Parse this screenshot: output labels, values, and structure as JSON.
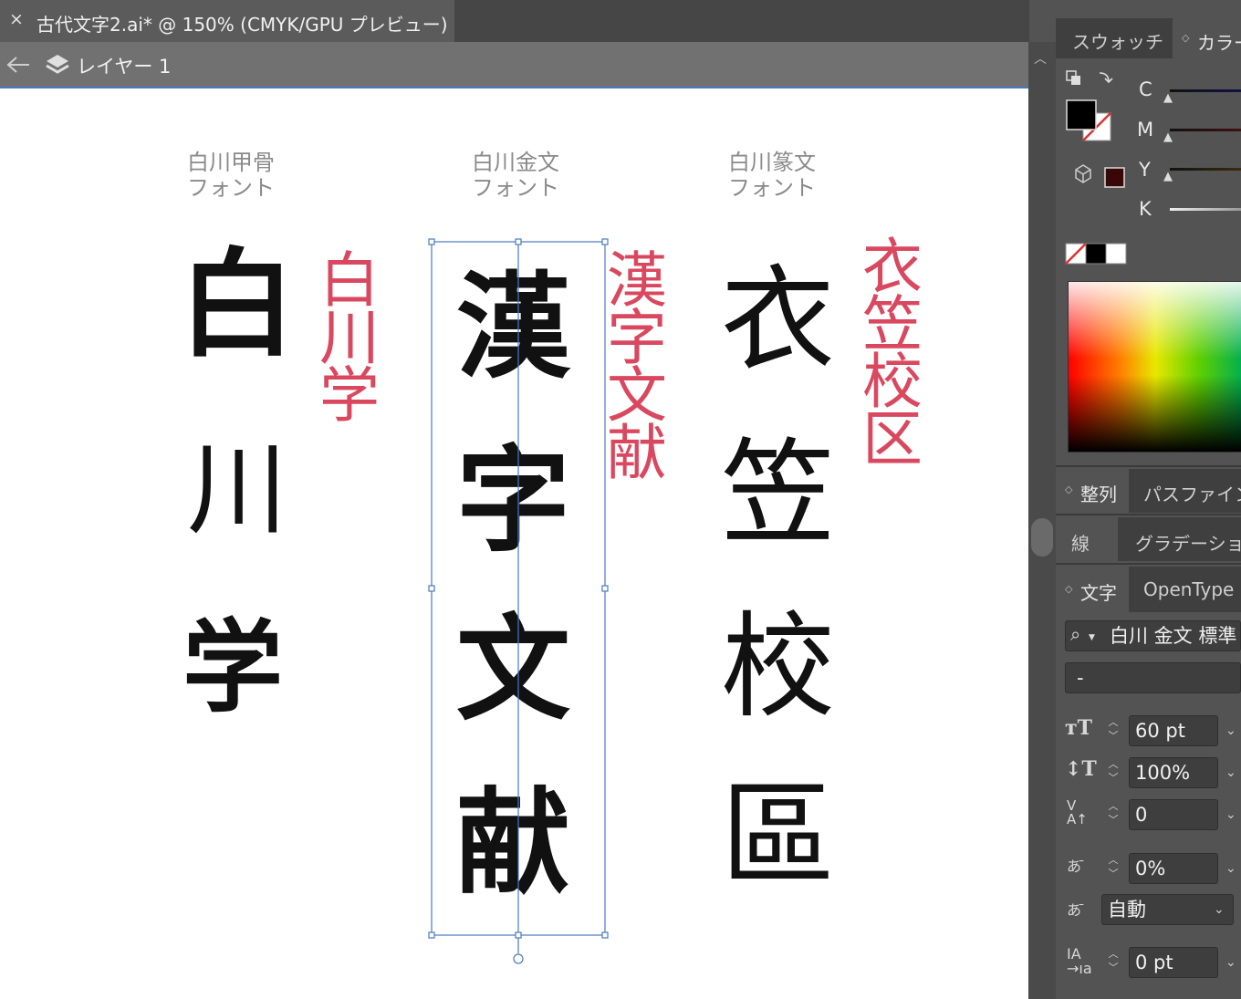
{
  "document_tab": {
    "close_icon": "×",
    "title": "古代文字2.ai* @ 150% (CMYK/GPU プレビュー)"
  },
  "layer_bar": {
    "layer_name": "レイヤー 1"
  },
  "canvas": {
    "columns": [
      {
        "label": "白川甲骨\nフォント",
        "red_text": "白川学",
        "seal_chars": [
          "白",
          "川",
          "学"
        ]
      },
      {
        "label": "白川金文\nフォント",
        "red_text": "漢字文献",
        "seal_chars": [
          "漢",
          "字",
          "文",
          "献"
        ]
      },
      {
        "label": "白川篆文\nフォント",
        "red_text": "衣笠校区",
        "seal_chars": [
          "衣",
          "笠",
          "校",
          "區"
        ]
      }
    ],
    "accent_color": "#d9485f",
    "selection_color": "#4a79c2"
  },
  "panel": {
    "tabs_top": [
      "スウォッチ",
      "カラー"
    ],
    "cmyk_labels": [
      "C",
      "M",
      "Y",
      "K"
    ],
    "tabs_align": [
      "整列",
      "パスファインダー"
    ],
    "tabs_stroke": [
      "線",
      "グラデーション"
    ],
    "tabs_char": [
      "文字",
      "OpenType"
    ],
    "font_family": "白川 金文 標準",
    "font_style": "-",
    "font_size": "60 pt",
    "leading": "100%",
    "kerning": "0",
    "tsume": "0%",
    "aki": "自動",
    "tracking": "0 pt"
  }
}
